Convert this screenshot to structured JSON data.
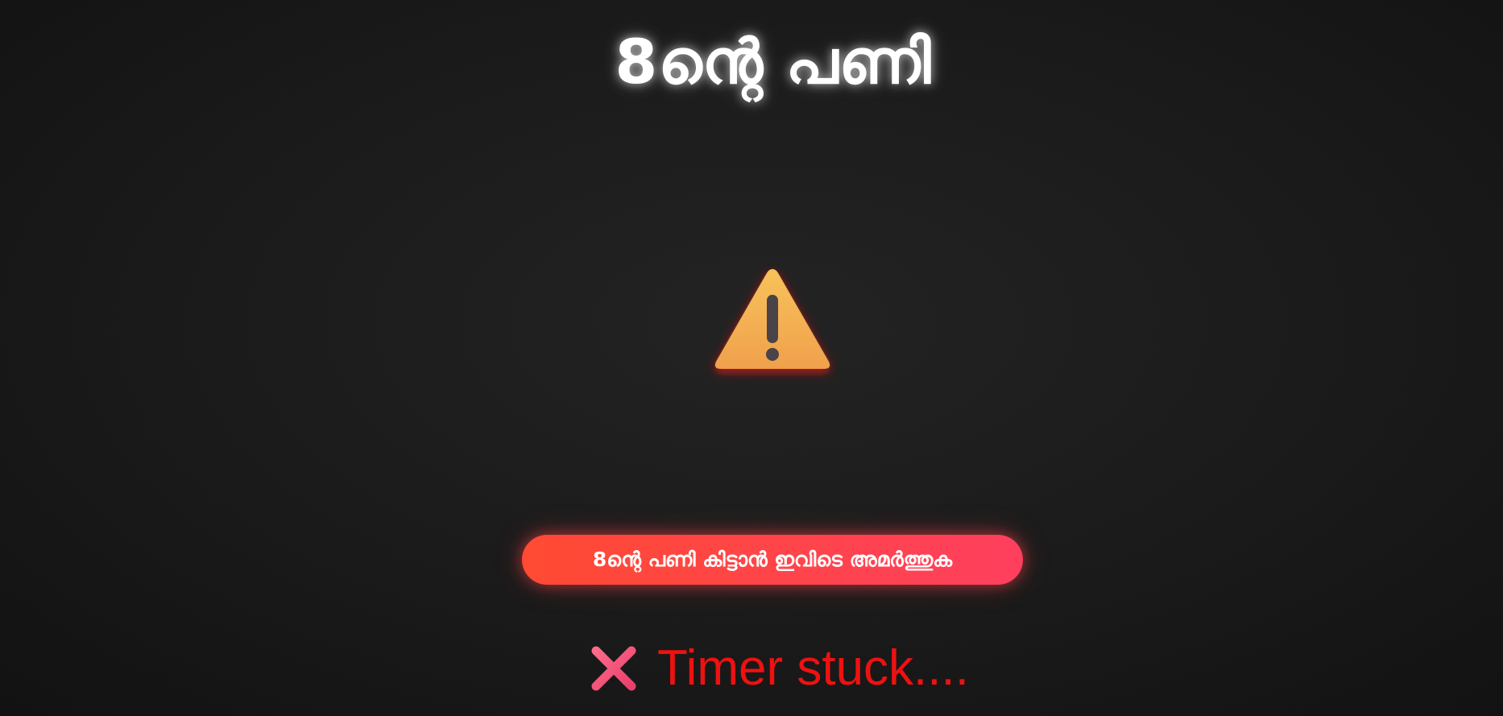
{
  "page": {
    "title": "8ന്റെ പണി"
  },
  "icons": {
    "warning": "warning-icon",
    "status": "cross-mark-icon"
  },
  "cta": {
    "label": "8ന്റെ പണി കിട്ടാൻ ഇവിടെ അമർത്തുക"
  },
  "status": {
    "text": "Timer stuck...."
  },
  "colors": {
    "background": "#1c1c1c",
    "title": "#ffffff",
    "button_start": "#ff4a33",
    "button_end": "#ff3f5e",
    "status_text": "#ee1111",
    "warning_fill": "#f5b04f",
    "cross": "#f2557f"
  }
}
